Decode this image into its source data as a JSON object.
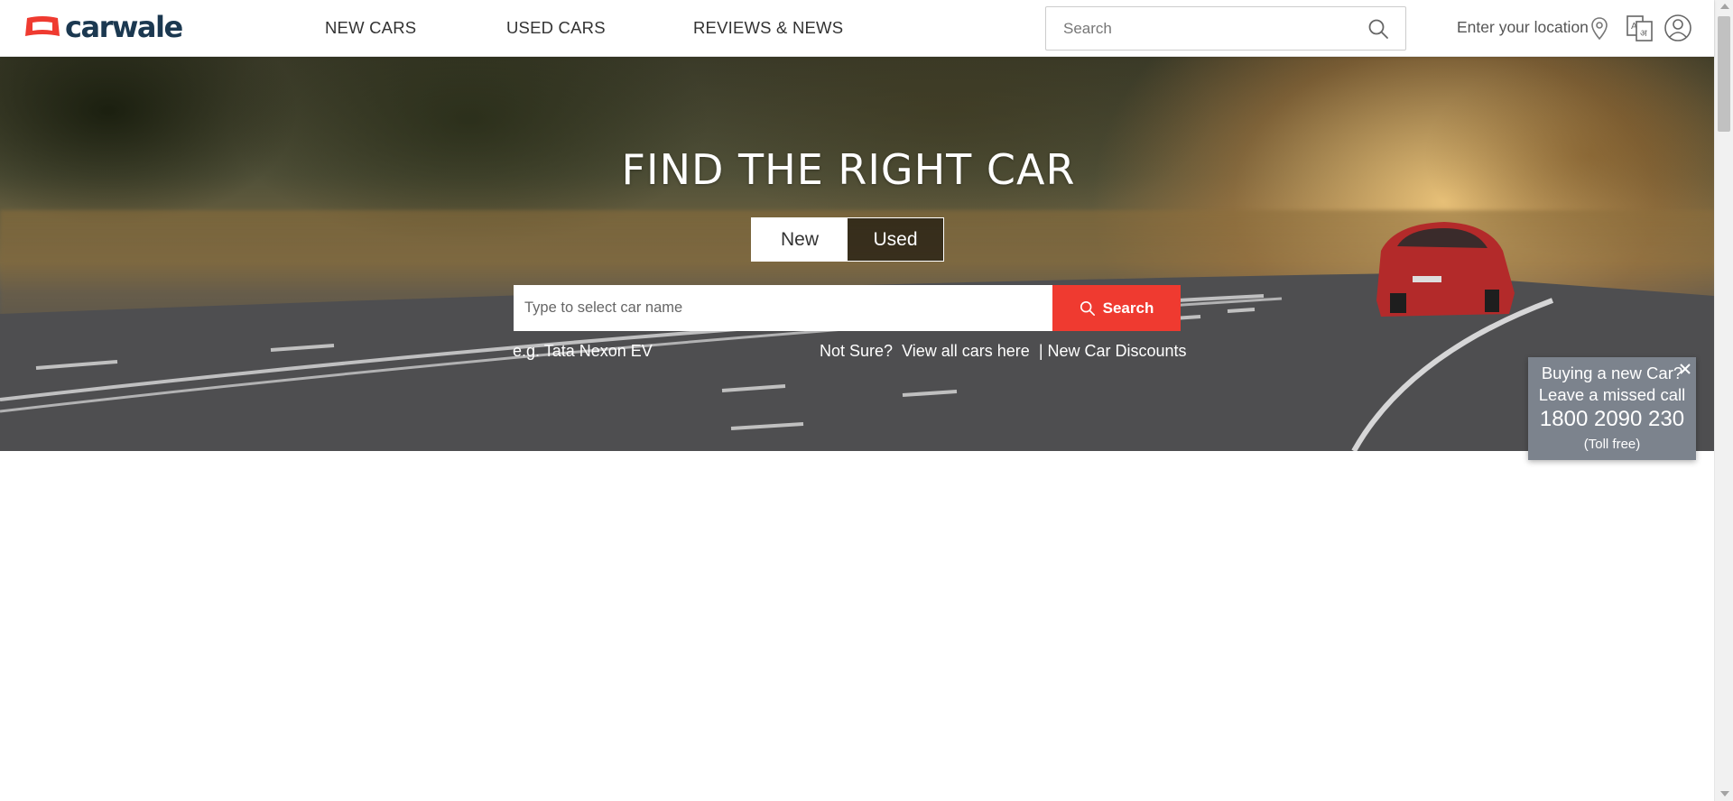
{
  "header": {
    "logo_text": "carwale",
    "brand_color": "#ef3a30",
    "logo_text_color": "#1b3850",
    "nav": [
      {
        "label": "NEW CARS"
      },
      {
        "label": "USED CARS"
      },
      {
        "label": "REVIEWS & NEWS"
      }
    ],
    "search": {
      "placeholder": "Search",
      "icon": "search-icon"
    },
    "location_label": "Enter your location",
    "icons": [
      "location-pin-icon",
      "language-icon",
      "user-account-icon"
    ]
  },
  "hero": {
    "title": "FIND THE RIGHT CAR",
    "toggle": {
      "new_label": "New",
      "used_label": "Used",
      "selected": "New"
    },
    "car_search": {
      "placeholder": "Type to select car name",
      "button_label": "Search",
      "button_color": "#ef3a30"
    },
    "example": {
      "prefix": "e.g.",
      "suggestion": "Tata Nexon EV"
    },
    "links": {
      "not_sure": "Not Sure?",
      "view_all": "View all cars here",
      "separator": "|",
      "discounts": "New Car Discounts"
    }
  },
  "call_widget": {
    "line1": "Buying a new Car?",
    "line2": "Leave a missed call",
    "phone": "1800 2090 230",
    "note": "(Toll free)",
    "background": "#7c838d"
  }
}
